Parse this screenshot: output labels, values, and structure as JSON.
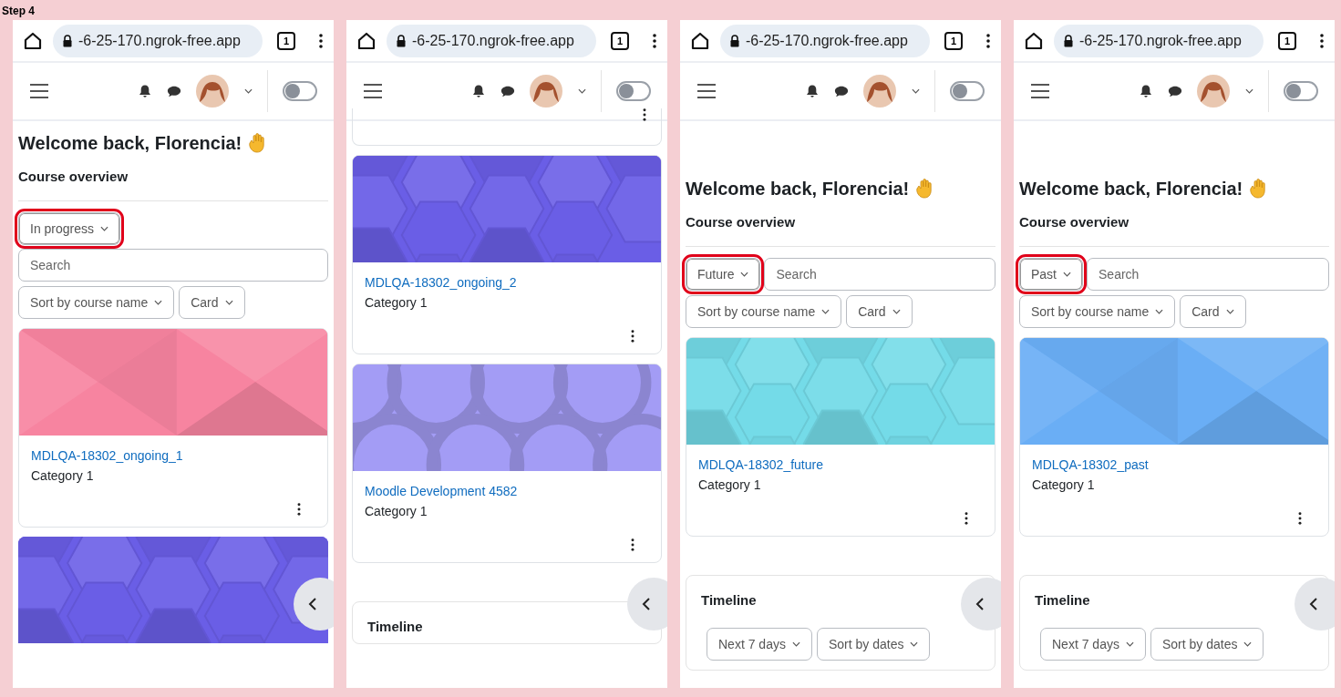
{
  "caption": "Step 4",
  "screens": [
    {
      "url": "-6-25-170.ngrok-free.app",
      "tab_count": "1",
      "switch": {
        "on": false
      },
      "blocks": [
        {
          "kind": "welcome",
          "text": "Welcome back, Florencia!"
        },
        {
          "kind": "overview",
          "title": "Course overview",
          "filter_on_own_row": true,
          "filter": {
            "label": "In progress",
            "highlighted": true
          },
          "search": {
            "placeholder": "Search"
          },
          "sort": {
            "label": "Sort by course name"
          },
          "view": {
            "label": "Card"
          }
        },
        {
          "kind": "course",
          "name": "MDLQA-18302_ongoing_1",
          "category": "Category 1",
          "image": {
            "kind": "triangles",
            "color": "#f784a0"
          }
        },
        {
          "kind": "course_image",
          "image": {
            "kind": "hexagons",
            "color": "#6a5ee6"
          }
        }
      ]
    },
    {
      "url": "-6-25-170.ngrok-free.app",
      "tab_count": "1",
      "switch": {
        "on": false
      },
      "blocks": [
        {
          "kind": "card_end"
        },
        {
          "kind": "course",
          "name": "MDLQA-18302_ongoing_2",
          "category": "Category 1",
          "image": {
            "kind": "hexagons",
            "color": "#6a5ee6"
          }
        },
        {
          "kind": "course",
          "name": "Moodle Development 4582",
          "category": "Category 1",
          "image": {
            "kind": "circles",
            "color": "#a39cf5"
          }
        },
        {
          "kind": "timeline",
          "title": "Timeline"
        }
      ]
    },
    {
      "url": "-6-25-170.ngrok-free.app",
      "tab_count": "1",
      "switch": {
        "on": false
      },
      "blocks": [
        {
          "kind": "blank"
        },
        {
          "kind": "welcome",
          "text": "Welcome back, Florencia!"
        },
        {
          "kind": "overview",
          "title": "Course overview",
          "filter_on_own_row": false,
          "filter": {
            "label": "Future",
            "highlighted": true
          },
          "search": {
            "placeholder": "Search"
          },
          "sort": {
            "label": "Sort by course name"
          },
          "view": {
            "label": "Card"
          }
        },
        {
          "kind": "course",
          "name": "MDLQA-18302_future",
          "category": "Category 1",
          "image": {
            "kind": "hexagons",
            "color": "#74dbe8"
          }
        },
        {
          "kind": "timeline",
          "title": "Timeline",
          "filters": [
            "Next 7 days",
            "Sort by dates"
          ]
        }
      ]
    },
    {
      "url": "-6-25-170.ngrok-free.app",
      "tab_count": "1",
      "switch": {
        "on": false
      },
      "blocks": [
        {
          "kind": "blank"
        },
        {
          "kind": "welcome",
          "text": "Welcome back, Florencia!"
        },
        {
          "kind": "overview",
          "title": "Course overview",
          "filter_on_own_row": false,
          "filter": {
            "label": "Past",
            "highlighted": true
          },
          "search": {
            "placeholder": "Search"
          },
          "sort": {
            "label": "Sort by course name"
          },
          "view": {
            "label": "Card"
          }
        },
        {
          "kind": "course",
          "name": "MDLQA-18302_past",
          "category": "Category 1",
          "image": {
            "kind": "triangles",
            "color": "#6aaef5"
          }
        },
        {
          "kind": "timeline",
          "title": "Timeline",
          "filters": [
            "Next 7 days",
            "Sort by dates"
          ]
        }
      ]
    }
  ]
}
